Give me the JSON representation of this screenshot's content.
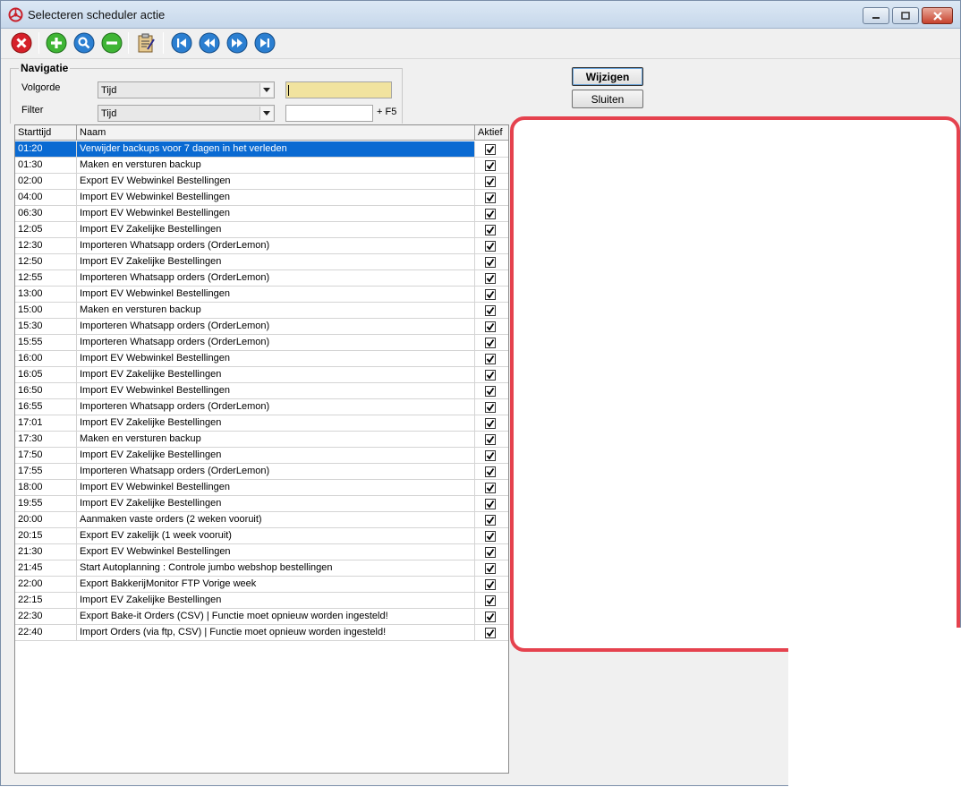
{
  "window": {
    "title": "Selecteren scheduler actie"
  },
  "toolbar": {
    "icons": [
      "delete-icon",
      "add-icon",
      "search-icon",
      "remove-icon",
      "clipboard-icon",
      "first-icon",
      "previous-icon",
      "next-icon",
      "last-icon"
    ]
  },
  "navigation": {
    "legend": "Navigatie",
    "volgorde_label": "Volgorde",
    "volgorde_value": "Tijd",
    "filter_label": "Filter",
    "filter_value": "Tijd",
    "search_value": "",
    "filter_text": "",
    "hotkey": "+ F5"
  },
  "buttons": {
    "wijzigen": "Wijzigen",
    "sluiten": "Sluiten"
  },
  "table": {
    "headers": [
      "Starttijd",
      "Naam",
      "Aktief"
    ],
    "rows": [
      {
        "time": "01:20",
        "name": "Verwijder backups voor 7 dagen in het verleden",
        "active": true
      },
      {
        "time": "01:30",
        "name": "Maken en versturen backup",
        "active": true
      },
      {
        "time": "02:00",
        "name": "Export EV Webwinkel Bestellingen",
        "active": true
      },
      {
        "time": "04:00",
        "name": "Import EV Webwinkel Bestellingen",
        "active": true
      },
      {
        "time": "06:30",
        "name": "Import EV Webwinkel Bestellingen",
        "active": true
      },
      {
        "time": "12:05",
        "name": "Import EV Zakelijke Bestellingen",
        "active": true
      },
      {
        "time": "12:30",
        "name": "Importeren Whatsapp orders (OrderLemon)",
        "active": true
      },
      {
        "time": "12:50",
        "name": "Import EV Zakelijke Bestellingen",
        "active": true
      },
      {
        "time": "12:55",
        "name": "Importeren Whatsapp orders (OrderLemon)",
        "active": true
      },
      {
        "time": "13:00",
        "name": "Import EV Webwinkel Bestellingen",
        "active": true
      },
      {
        "time": "15:00",
        "name": "Maken en versturen backup",
        "active": true
      },
      {
        "time": "15:30",
        "name": "Importeren Whatsapp orders (OrderLemon)",
        "active": true
      },
      {
        "time": "15:55",
        "name": "Importeren Whatsapp orders (OrderLemon)",
        "active": true
      },
      {
        "time": "16:00",
        "name": "Import EV Webwinkel Bestellingen",
        "active": true
      },
      {
        "time": "16:05",
        "name": "Import EV Zakelijke Bestellingen",
        "active": true
      },
      {
        "time": "16:50",
        "name": "Import EV Webwinkel Bestellingen",
        "active": true
      },
      {
        "time": "16:55",
        "name": "Importeren Whatsapp orders (OrderLemon)",
        "active": true
      },
      {
        "time": "17:01",
        "name": "Import EV Zakelijke Bestellingen",
        "active": true
      },
      {
        "time": "17:30",
        "name": "Maken en versturen backup",
        "active": true
      },
      {
        "time": "17:50",
        "name": "Import EV Zakelijke Bestellingen",
        "active": true
      },
      {
        "time": "17:55",
        "name": "Importeren Whatsapp orders (OrderLemon)",
        "active": true
      },
      {
        "time": "18:00",
        "name": "Import EV Webwinkel Bestellingen",
        "active": true
      },
      {
        "time": "19:55",
        "name": "Import EV Zakelijke Bestellingen",
        "active": true
      },
      {
        "time": "20:00",
        "name": "Aanmaken vaste orders (2 weken vooruit)",
        "active": true
      },
      {
        "time": "20:15",
        "name": "Export EV zakelijk (1 week vooruit)",
        "active": true
      },
      {
        "time": "21:30",
        "name": "Export EV Webwinkel Bestellingen",
        "active": true
      },
      {
        "time": "21:45",
        "name": "Start Autoplanning : Controle jumbo webshop bestellingen",
        "active": true
      },
      {
        "time": "22:00",
        "name": "Export BakkerijMonitor FTP Vorige week",
        "active": true
      },
      {
        "time": "22:15",
        "name": "Import EV Zakelijke Bestellingen",
        "active": true
      },
      {
        "time": "22:30",
        "name": "Export Bake-it Orders (CSV) | Functie moet opnieuw worden ingesteld!",
        "active": true
      },
      {
        "time": "22:40",
        "name": "Import Orders (via ftp, CSV) | Functie moet opnieuw worden ingesteld!",
        "active": true
      }
    ],
    "selected_index": 0
  },
  "colors": {
    "selection": "#0a6ad2",
    "highlight": "#e5424e",
    "search_field": "#f1e39f"
  }
}
